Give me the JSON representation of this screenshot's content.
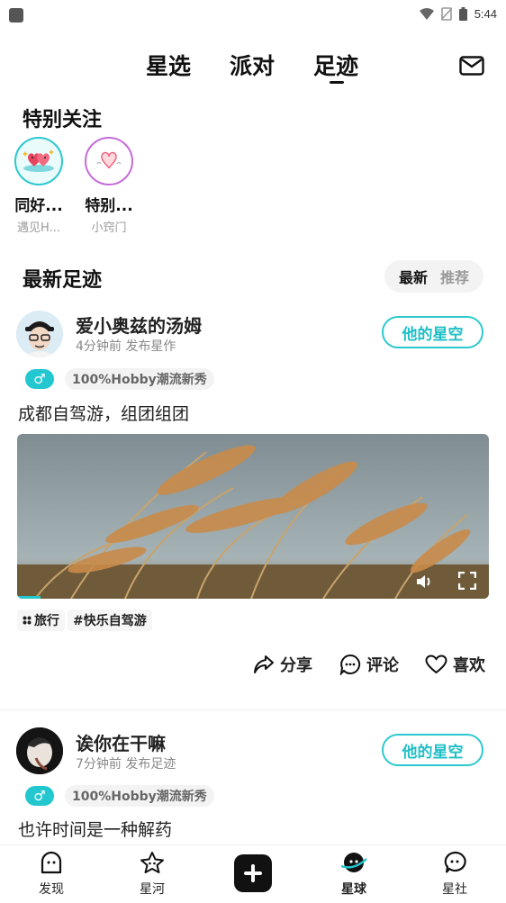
{
  "status_bar": {
    "time": "5:44"
  },
  "top_tabs": [
    "星选",
    "派对",
    "足迹"
  ],
  "special_follow": {
    "title": "特别关注",
    "items": [
      {
        "name": "同好...",
        "subtitle": "遇见H..."
      },
      {
        "name": "特别...",
        "subtitle": "小窍门"
      }
    ]
  },
  "latest": {
    "title": "最新足迹",
    "sort_options": [
      "最新",
      "推荐"
    ],
    "selected_sort": "最新"
  },
  "posts": [
    {
      "username": "爱小奥兹的汤姆",
      "time": "4分钟前 发布星作",
      "star_button": "他的星空",
      "gender_symbol": "♂",
      "hobby_tag": "100%Hobby潮流新秀",
      "content": "成都自驾游，组团组团",
      "tags": [
        "旅行",
        "#快乐自驾游"
      ],
      "actions": {
        "share": "分享",
        "comment": "评论",
        "like": "喜欢"
      }
    },
    {
      "username": "诶你在干嘛",
      "time": "7分钟前 发布足迹",
      "star_button": "他的星空",
      "gender_symbol": "♂",
      "hobby_tag": "100%Hobby潮流新秀",
      "content": "也许时间是一种解药"
    }
  ],
  "bottom_nav": [
    "发现",
    "星河",
    "星球",
    "星社"
  ],
  "active_nav": "星球",
  "colors": {
    "accent": "#22c7cf",
    "text": "#111111",
    "muted": "#888888"
  }
}
